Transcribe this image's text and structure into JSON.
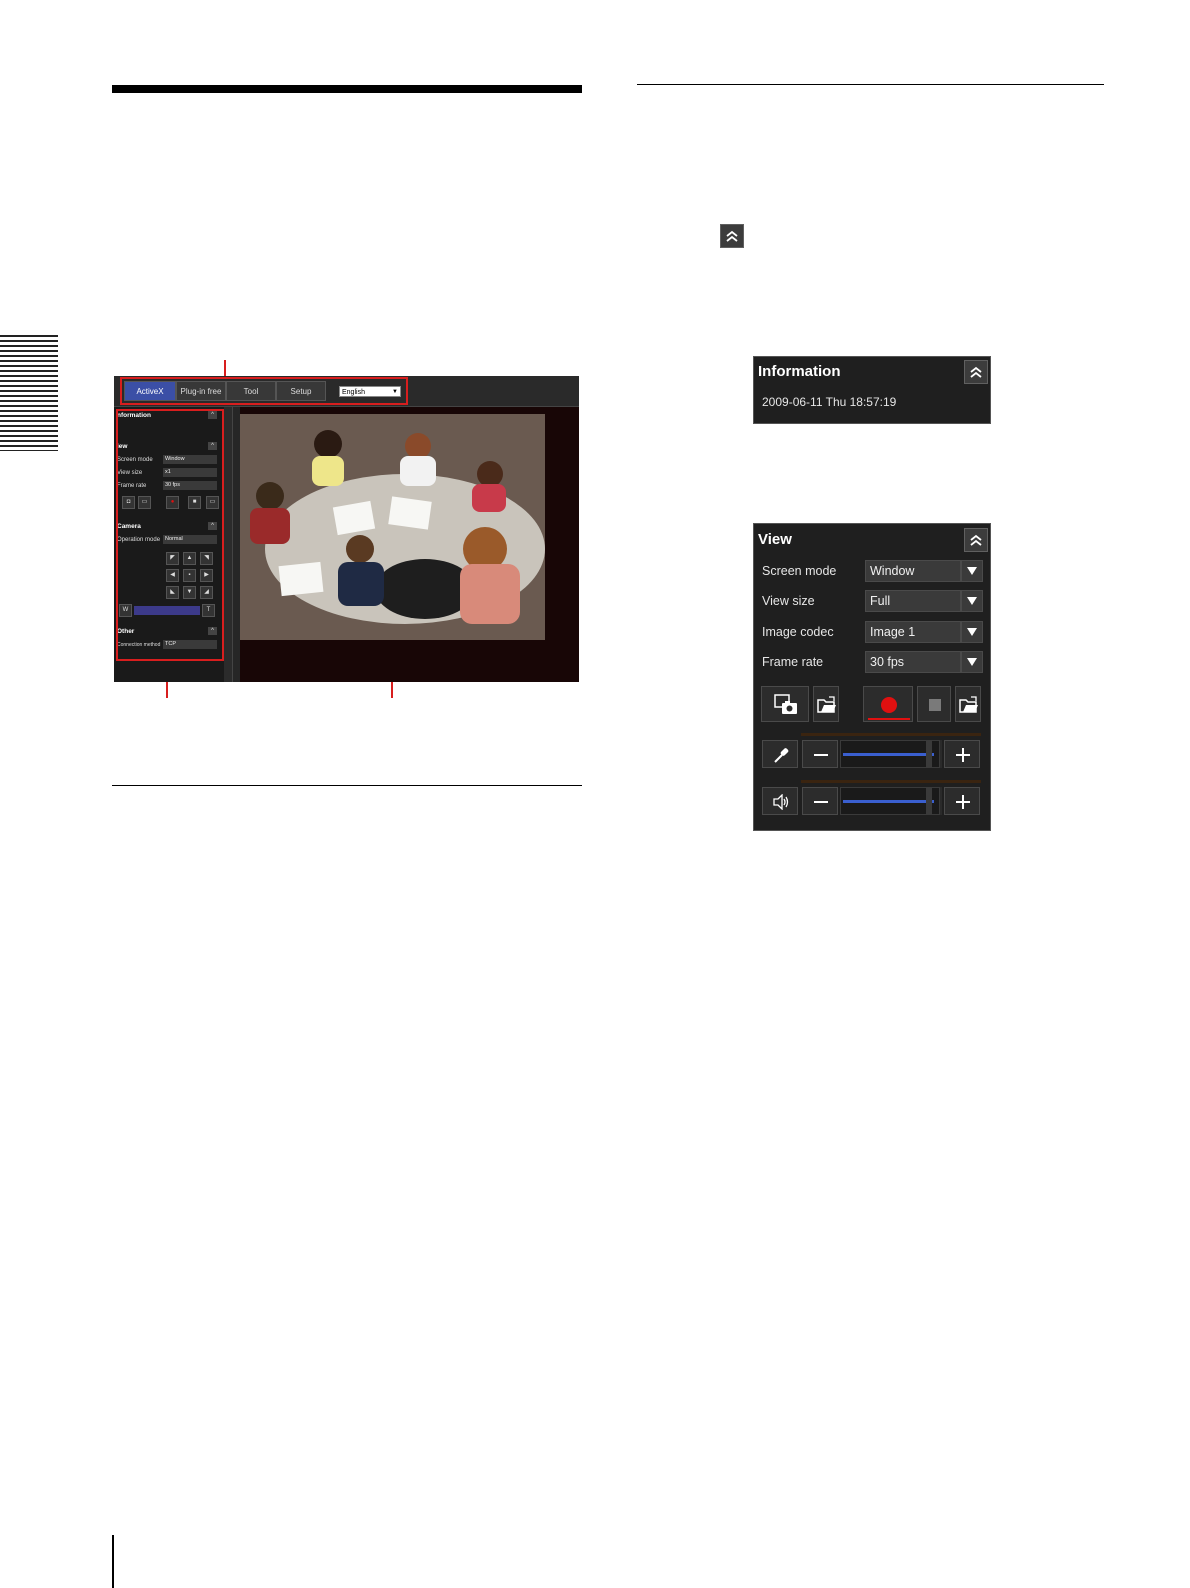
{
  "main_screenshot": {
    "menu": {
      "activex": "ActiveX",
      "plugin_free": "Plug-in free",
      "tool": "Tool",
      "setup": "Setup",
      "language": "English"
    },
    "panel": {
      "information": "nformation",
      "view": "iew",
      "screen_mode_label": "Screen mode",
      "screen_mode_value": "Window",
      "view_size_label": "View size",
      "view_size_value": "x1",
      "frame_rate_label": "Frame rate",
      "frame_rate_value": "30 fps",
      "camera": "Camera",
      "operation_mode_label": "Operation mode",
      "operation_mode_value": "Normal",
      "zoom_wide": "W",
      "zoom_tele": "T",
      "other": "Other",
      "connection_method_label": "Connection method",
      "connection_method_value": "TCP"
    }
  },
  "information_panel": {
    "title": "Information",
    "datetime": "2009-06-11 Thu 18:57:19"
  },
  "view_panel": {
    "title": "View",
    "rows": [
      {
        "label": "Screen mode",
        "value": "Window"
      },
      {
        "label": "View size",
        "value": "Full"
      },
      {
        "label": "Image codec",
        "value": "Image 1"
      },
      {
        "label": "Frame rate",
        "value": "30 fps"
      }
    ],
    "mic_level": 0.95,
    "volume_level": 0.95
  },
  "colors": {
    "callout": "#d81e1e",
    "record": "#e01010",
    "accent_blue": "#3b4fa6"
  }
}
